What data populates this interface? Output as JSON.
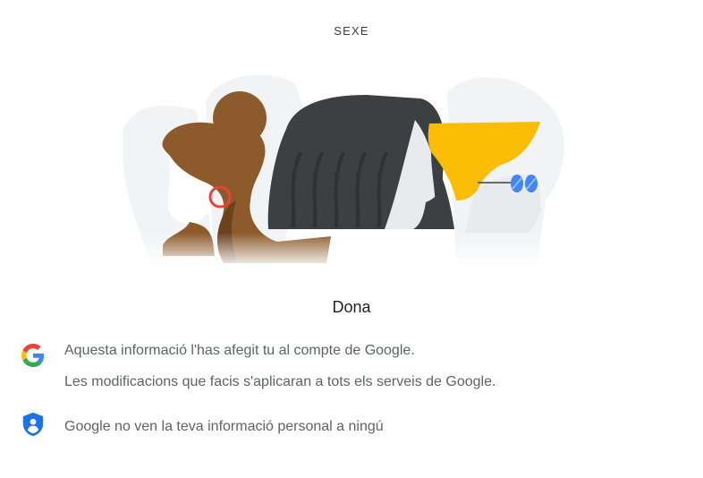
{
  "section": {
    "title": "SEXE"
  },
  "illustration": {
    "name": "gender-illustration"
  },
  "value": {
    "label": "Dona"
  },
  "info": {
    "account_line1": "Aquesta informació l'has afegit tu al compte de Google.",
    "account_line2": "Les modificacions que facis s'aplicaran a tots els serveis de Google.",
    "privacy_line": "Google no ven la teva informació personal a ningú"
  },
  "icons": {
    "account": "google-g-icon",
    "privacy": "shield-person-icon"
  },
  "colors": {
    "text_primary": "#202124",
    "text_secondary": "#5f6368",
    "shield_blue": "#1a73e8",
    "hair_brown": "#8d5a2b",
    "hair_dark": "#3c4043",
    "hair_yellow": "#fbbc04"
  }
}
